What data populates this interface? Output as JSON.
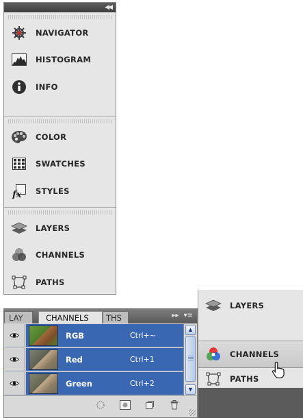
{
  "dock_top": {
    "collapse_button": "◀◀",
    "groups": [
      {
        "items": [
          {
            "label": "NAVIGATOR",
            "icon": "navigator-icon"
          },
          {
            "label": "HISTOGRAM",
            "icon": "histogram-icon"
          },
          {
            "label": "INFO",
            "icon": "info-icon"
          }
        ]
      },
      {
        "items": [
          {
            "label": "COLOR",
            "icon": "color-palette-icon"
          },
          {
            "label": "SWATCHES",
            "icon": "swatches-icon"
          },
          {
            "label": "STYLES",
            "icon": "styles-fx-icon"
          }
        ]
      },
      {
        "items": [
          {
            "label": "LAYERS",
            "icon": "layers-icon"
          },
          {
            "label": "CHANNELS",
            "icon": "channels-icon"
          },
          {
            "label": "PATHS",
            "icon": "paths-icon"
          }
        ]
      }
    ]
  },
  "channels_panel": {
    "tabs": [
      {
        "label": "LAY"
      },
      {
        "label": "CHANNELS"
      },
      {
        "label": "THS"
      }
    ],
    "tab_controls": {
      "expand": "▸▸",
      "menu": "▾≡"
    },
    "rows": [
      {
        "name": "RGB",
        "shortcut": "Ctrl+~",
        "thumb_color": "#5e8a3a"
      },
      {
        "name": "Red",
        "shortcut": "Ctrl+1",
        "thumb_color": "#8a8a6e"
      },
      {
        "name": "Green",
        "shortcut": "Ctrl+2",
        "thumb_color": "#8e8e70"
      }
    ]
  },
  "dock_bottom": {
    "items": [
      {
        "label": "LAYERS",
        "icon": "layers-icon"
      },
      {
        "label": "CHANNELS",
        "icon": "channels-icon"
      },
      {
        "label": "PATHS",
        "icon": "paths-icon"
      }
    ]
  },
  "colors": {
    "selection": "#3a67b2",
    "panel_bg": "#e6e6e6",
    "header": "#4a4a4a"
  }
}
